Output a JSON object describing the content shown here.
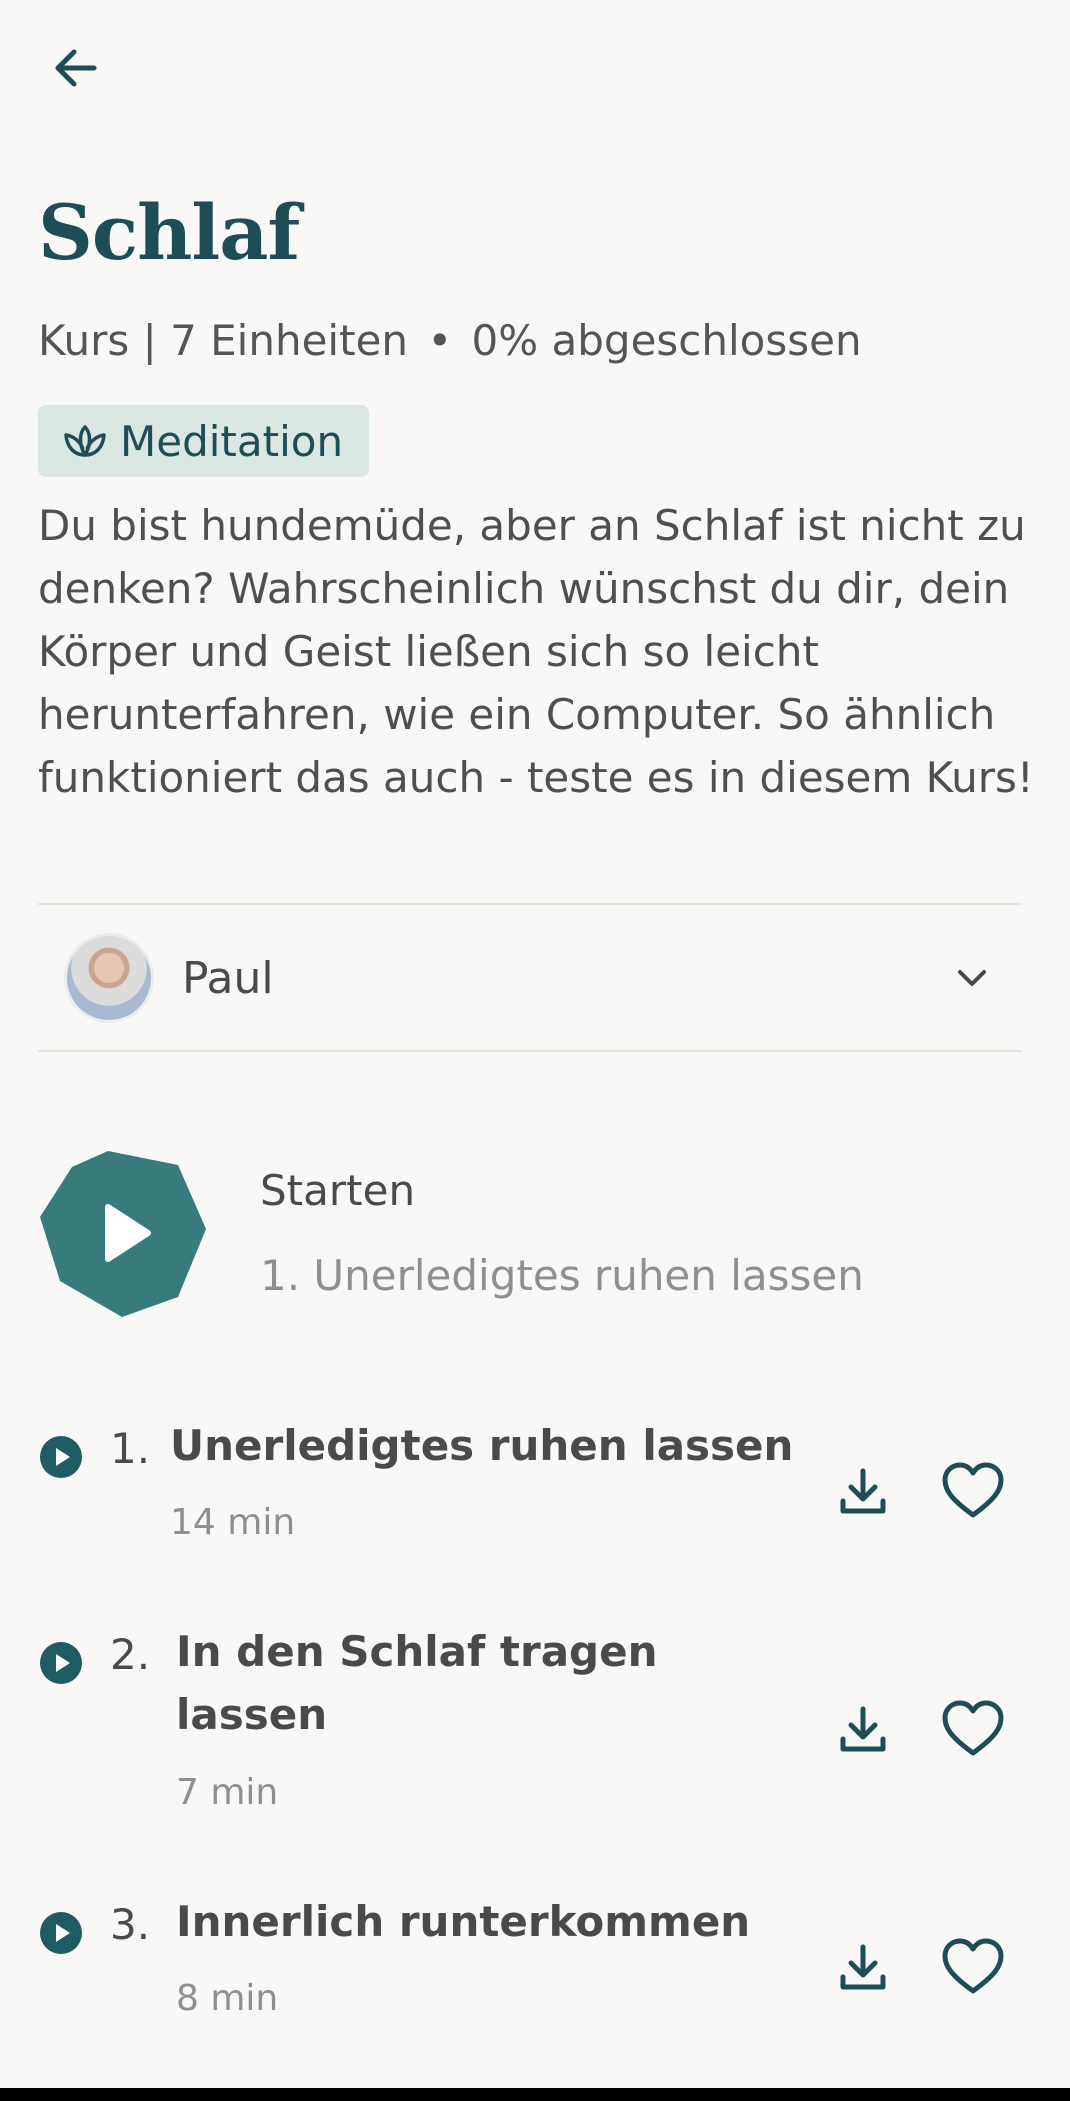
{
  "header": {
    "title": "Schlaf",
    "meta_course": "Kurs | 7 Einheiten",
    "meta_dot": "•",
    "meta_progress": "0% abgeschlossen",
    "tag_label": "Meditation"
  },
  "description": "Du bist hundemüde, aber an Schlaf ist nicht zu denken? Wahrscheinlich wünschst du dir, dein Körper und Geist ließen sich so leicht herunterfahren, wie ein Computer. So ähnlich funktioniert das auch - teste es in diesem Kurs!",
  "teacher": {
    "name": "Paul"
  },
  "start": {
    "label": "Starten",
    "next_lesson": "1. Unerledigtes ruhen lassen"
  },
  "lessons": [
    {
      "number": "1.",
      "title": "Unerledigtes ruhen lassen",
      "title_line2": "",
      "duration": "14 min"
    },
    {
      "number": "2.",
      "title": "In den Schlaf tragen",
      "title_line2": "lassen",
      "duration": "7 min"
    },
    {
      "number": "3.",
      "title": "Innerlich runterkommen",
      "title_line2": "",
      "duration": "8 min"
    }
  ],
  "colors": {
    "accent": "#377b7d",
    "title": "#1f4d56",
    "tag_bg": "#dbe7e2",
    "background": "#f9f8f6"
  },
  "icons": {
    "back": "arrow-left-icon",
    "tag": "lotus-icon",
    "chevron": "chevron-down-icon",
    "download": "download-icon",
    "favorite": "heart-icon",
    "play": "play-icon"
  }
}
